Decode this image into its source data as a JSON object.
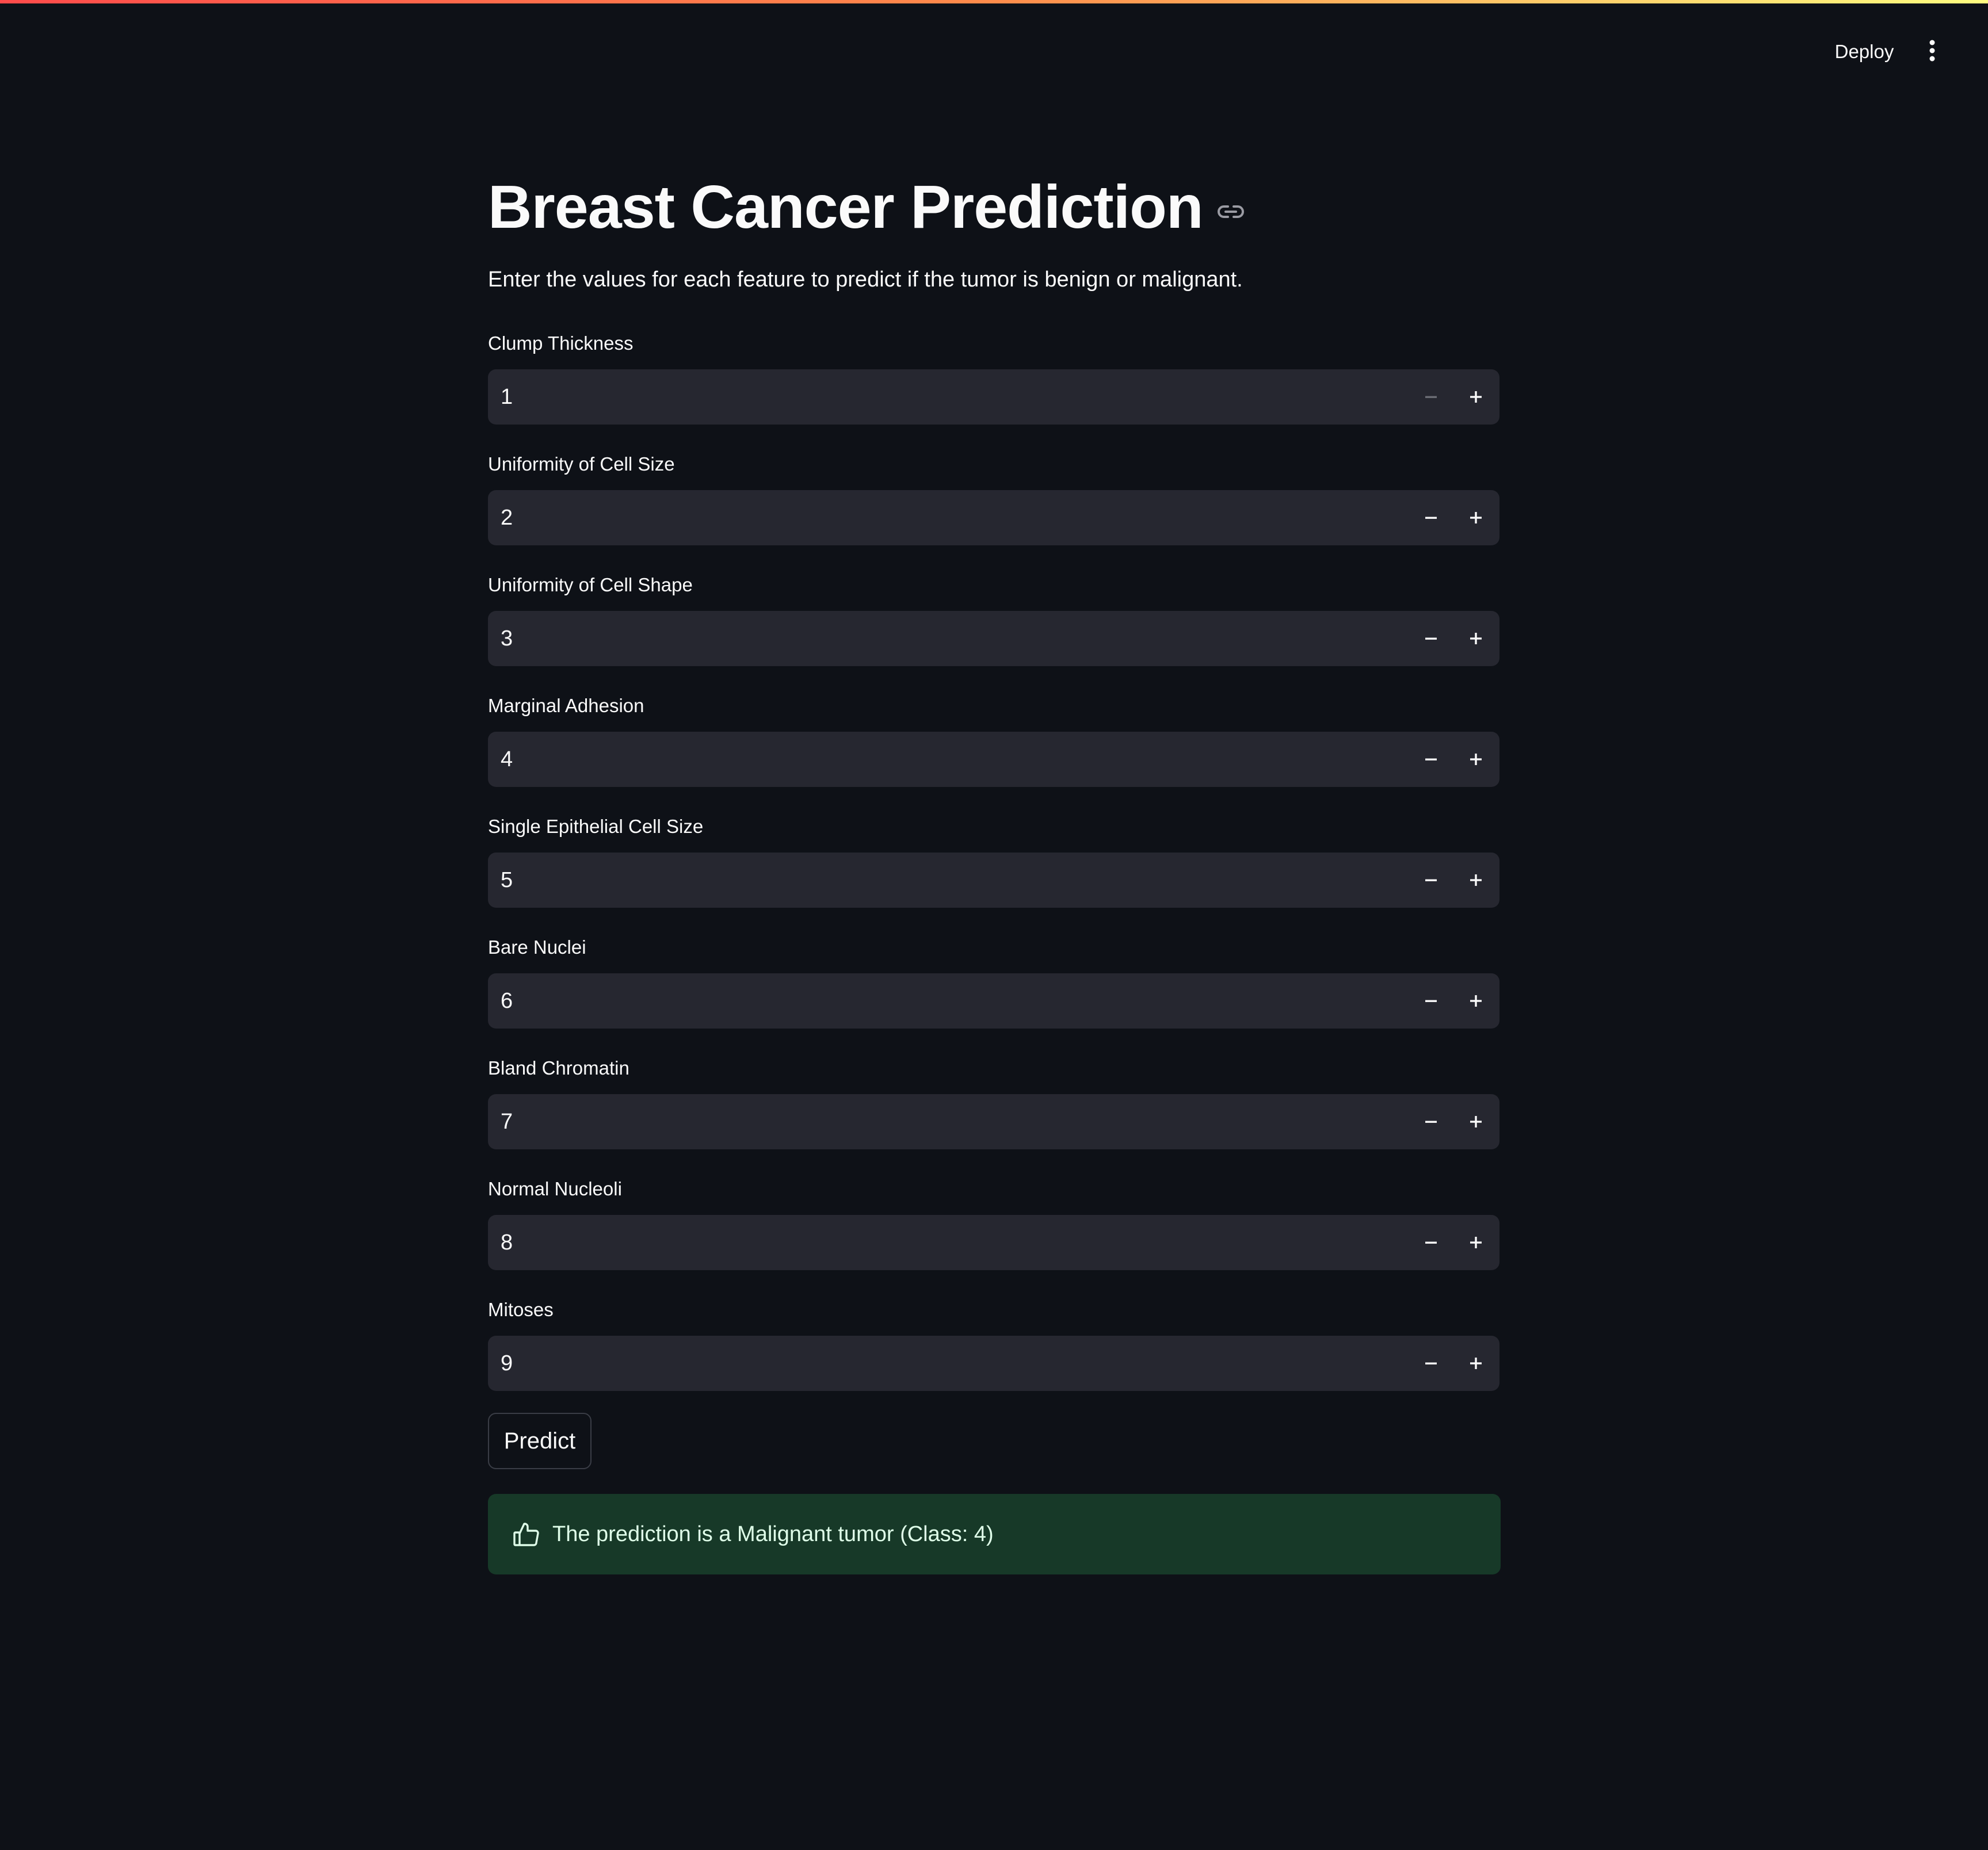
{
  "header": {
    "deploy_label": "Deploy",
    "menu_icon": "kebab-menu-icon"
  },
  "colors": {
    "background": "#0e1117",
    "input_background": "#262730",
    "success_background": "#173928",
    "success_text": "#dffde9",
    "accent_gradient": [
      "#ff4b4b",
      "#fffd80"
    ]
  },
  "main": {
    "title": "Breast Cancer Prediction",
    "title_icon": "link-icon",
    "subtitle": "Enter the values for each feature to predict if the tumor is benign or malignant.",
    "fields": [
      {
        "label": "Clump Thickness",
        "value": "1"
      },
      {
        "label": "Uniformity of Cell Size",
        "value": "2"
      },
      {
        "label": "Uniformity of Cell Shape",
        "value": "3"
      },
      {
        "label": "Marginal Adhesion",
        "value": "4"
      },
      {
        "label": "Single Epithelial Cell Size",
        "value": "5"
      },
      {
        "label": "Bare Nuclei",
        "value": "6"
      },
      {
        "label": "Bland Chromatin",
        "value": "7"
      },
      {
        "label": "Normal Nucleoli",
        "value": "8"
      },
      {
        "label": "Mitoses",
        "value": "9"
      }
    ],
    "predict_label": "Predict",
    "result": {
      "icon": "thumbs-up-icon",
      "text": "The prediction is a Malignant tumor (Class: 4)"
    }
  }
}
